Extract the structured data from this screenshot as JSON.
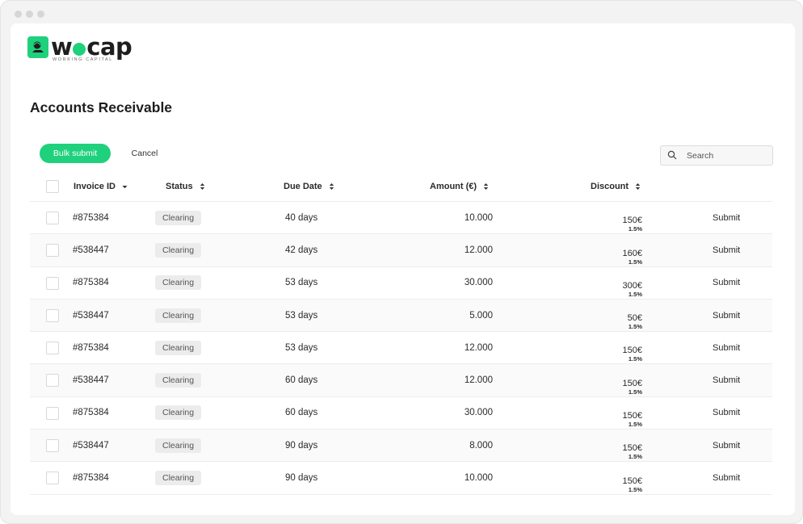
{
  "brand": {
    "name_prefix": "w",
    "name_suffix": "cap",
    "tagline": "WORKING CAPITAL",
    "accent_color": "#1fd17d"
  },
  "page": {
    "title": "Accounts Receivable"
  },
  "toolbar": {
    "bulk_submit_label": "Bulk submit",
    "cancel_label": "Cancel",
    "search_placeholder": "Search"
  },
  "table": {
    "columns": {
      "invoice_id": "Invoice ID",
      "status": "Status",
      "due_date": "Due Date",
      "amount": "Amount (€)",
      "discount": "Discount"
    },
    "rows": [
      {
        "invoice_id": "#875384",
        "status": "Clearing",
        "due_date": "40 days",
        "amount": "10.000",
        "discount": "150€",
        "discount_pct": "1.5%",
        "action": "Submit"
      },
      {
        "invoice_id": "#538447",
        "status": "Clearing",
        "due_date": "42 days",
        "amount": "12.000",
        "discount": "160€",
        "discount_pct": "1.5%",
        "action": "Submit"
      },
      {
        "invoice_id": "#875384",
        "status": "Clearing",
        "due_date": "53 days",
        "amount": "30.000",
        "discount": "300€",
        "discount_pct": "1.5%",
        "action": "Submit"
      },
      {
        "invoice_id": "#538447",
        "status": "Clearing",
        "due_date": "53 days",
        "amount": "5.000",
        "discount": "50€",
        "discount_pct": "1.5%",
        "action": "Submit"
      },
      {
        "invoice_id": "#875384",
        "status": "Clearing",
        "due_date": "53 days",
        "amount": "12.000",
        "discount": "150€",
        "discount_pct": "1.5%",
        "action": "Submit"
      },
      {
        "invoice_id": "#538447",
        "status": "Clearing",
        "due_date": "60 days",
        "amount": "12.000",
        "discount": "150€",
        "discount_pct": "1.5%",
        "action": "Submit"
      },
      {
        "invoice_id": "#875384",
        "status": "Clearing",
        "due_date": "60 days",
        "amount": "30.000",
        "discount": "150€",
        "discount_pct": "1.5%",
        "action": "Submit"
      },
      {
        "invoice_id": "#538447",
        "status": "Clearing",
        "due_date": "90 days",
        "amount": "8.000",
        "discount": "150€",
        "discount_pct": "1.5%",
        "action": "Submit"
      },
      {
        "invoice_id": "#875384",
        "status": "Clearing",
        "due_date": "90 days",
        "amount": "10.000",
        "discount": "150€",
        "discount_pct": "1.5%",
        "action": "Submit"
      }
    ]
  }
}
